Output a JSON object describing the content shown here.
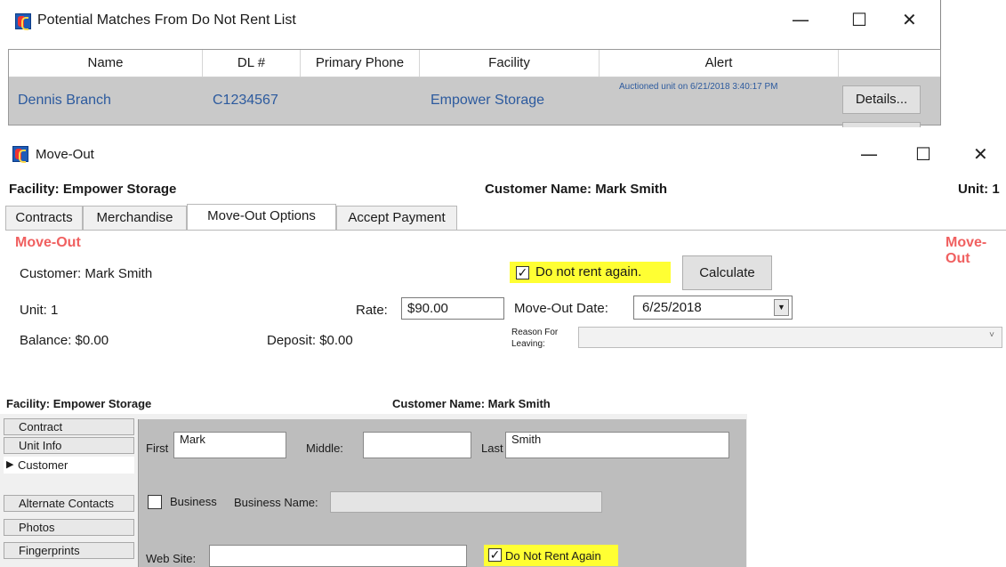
{
  "matches_window": {
    "title": "Potential Matches From Do Not Rent List",
    "controls": {
      "minimize": "—",
      "maximize": "☐",
      "close": "✕"
    },
    "columns": [
      "Name",
      "DL #",
      "Primary Phone",
      "Facility",
      "Alert",
      ""
    ],
    "rows": [
      {
        "name": "Dennis Branch",
        "dl": "C1234567",
        "phone": "",
        "facility": "Empower Storage",
        "alert": "Auctioned unit on 6/21/2018 3:40:17 PM",
        "details_label": "Details..."
      }
    ]
  },
  "moveout_window": {
    "title": "Move-Out",
    "controls": {
      "minimize": "—",
      "maximize": "☐",
      "close": "✕"
    },
    "facility_label": "Facility: Empower Storage",
    "customer_label": "Customer Name: Mark Smith",
    "unit_label": "Unit: 1",
    "tabs": [
      "Contracts",
      "Merchandise",
      "Move-Out Options",
      "Accept Payment"
    ],
    "active_tab": "Move-Out Options",
    "section_title": "Move-Out",
    "section_title_right": "Move-Out",
    "customer": "Customer: Mark Smith",
    "unit": "Unit: 1",
    "balance": "Balance: $0.00",
    "rate_label": "Rate:",
    "rate_value": "$90.00",
    "deposit": "Deposit: $0.00",
    "do_not_rent_label": "Do not rent again.",
    "do_not_rent_checked": true,
    "calculate_label": "Calculate",
    "moveout_date_label": "Move-Out Date:",
    "moveout_date_value": "6/25/2018",
    "reason_label_1": "Reason For",
    "reason_label_2": "Leaving:",
    "reason_value": ""
  },
  "customer_window": {
    "facility_label": "Facility: Empower Storage",
    "customer_label": "Customer Name: Mark Smith",
    "nav": [
      "Contract",
      "Unit Info",
      "Customer",
      "Alternate Contacts",
      "Photos",
      "Fingerprints"
    ],
    "active_nav": "Customer",
    "first_label": "First",
    "first_value": "Mark",
    "middle_label": "Middle:",
    "middle_value": "",
    "last_label": "Last",
    "last_value": "Smith",
    "business_label": "Business",
    "business_name_label": "Business Name:",
    "business_name_value": "",
    "website_label": "Web Site:",
    "website_value": "",
    "do_not_rent_label": "Do Not Rent Again",
    "do_not_rent_checked": true
  },
  "colors": {
    "highlight": "#ffff33",
    "link_blue": "#2c5a9e",
    "moveout_red": "#f06060",
    "grid_row": "#c9c9c9"
  }
}
